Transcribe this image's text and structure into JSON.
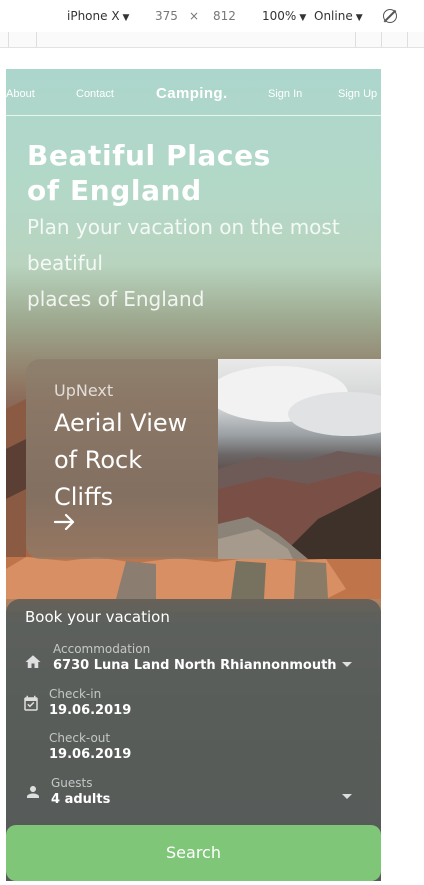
{
  "devtools": {
    "device": "iPhone X",
    "width": "375",
    "times": "×",
    "height": "812",
    "zoom": "100%",
    "network": "Online",
    "caret": "▼",
    "icon_rotate": "rotate-icon"
  },
  "nav": {
    "about": "About",
    "contact": "Contact",
    "brand": "Camping.",
    "sign_in": "Sign In",
    "sign_up": "Sign Up"
  },
  "hero": {
    "title_line1": "Beatiful Places",
    "title_line2": "of England",
    "subtitle_line1": "Plan your vacation on the most",
    "subtitle_line2": "beatiful",
    "subtitle_line3": "places of England"
  },
  "upnext": {
    "tag": "UpNext",
    "title_line1": "Aerial View",
    "title_line2": "of Rock",
    "title_line3": "Cliffs",
    "icon": "arrow-right-icon"
  },
  "booking": {
    "title": "Book your vacation",
    "accommodation": {
      "label": "Accommodation",
      "value": "6730 Luna Land North Rhiannonmouth",
      "icon": "home-icon"
    },
    "checkin": {
      "label": "Check-in",
      "value": "19.06.2019",
      "icon": "calendar-icon"
    },
    "checkout": {
      "label": "Check-out",
      "value": "19.06.2019"
    },
    "guests": {
      "label": "Guests",
      "value": "4 adults",
      "icon": "person-icon"
    }
  },
  "search": {
    "label": "Search"
  },
  "colors": {
    "search_button": "#7fc679",
    "panel": "#565a58"
  }
}
